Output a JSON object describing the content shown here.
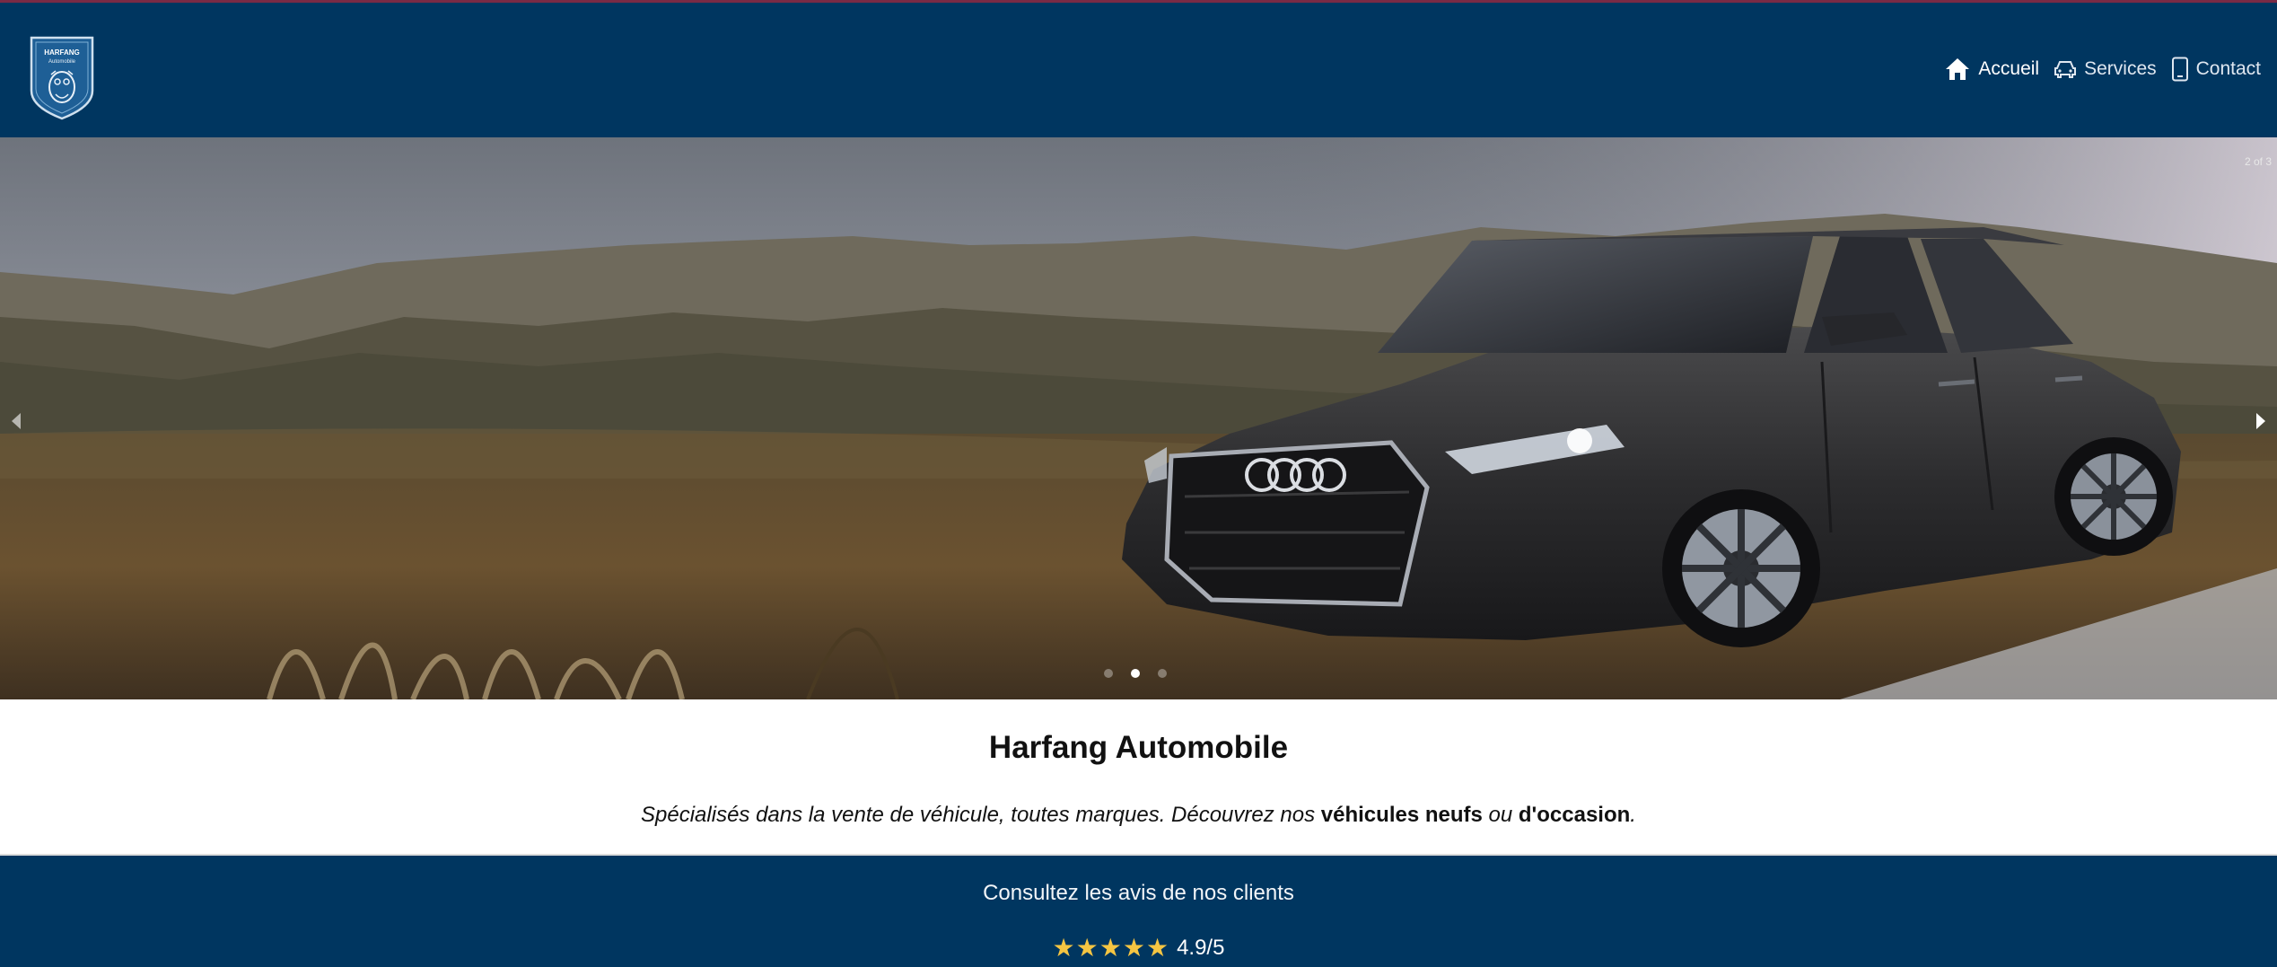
{
  "brand": {
    "logo_line1": "HARFANG",
    "logo_line2": "Automobile"
  },
  "nav": {
    "items": [
      {
        "label": "Accueil",
        "icon": "home-icon"
      },
      {
        "label": "Services",
        "icon": "car-icon"
      },
      {
        "label": "Contact",
        "icon": "phone-icon"
      }
    ]
  },
  "carousel": {
    "counter": "2 of 3",
    "slides": 3,
    "active_slide": 2,
    "prev_icon": "chevron-left-icon",
    "next_icon": "chevron-right-icon"
  },
  "intro": {
    "title": "Harfang Automobile",
    "text_before": "Spécialisés dans la vente de véhicule, toutes marques. Découvrez nos ",
    "bold_new": "véhicules neufs",
    "text_middle": " ou ",
    "bold_used": "d'occasion",
    "text_after": "."
  },
  "reviews": {
    "title": "Consultez les avis de nos clients",
    "stars": "★★★★★",
    "score": "4.9/5"
  },
  "colors": {
    "navy": "#003660",
    "star": "#f5c542"
  }
}
